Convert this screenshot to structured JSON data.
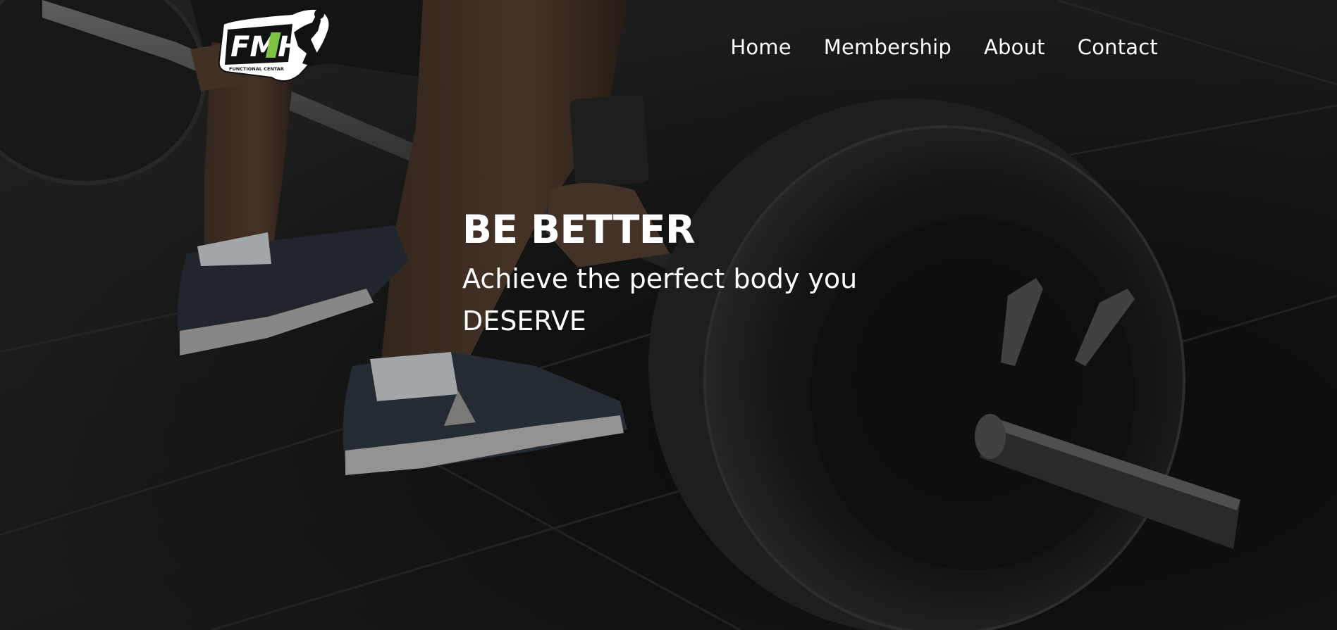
{
  "brand": {
    "logo_text": "FMH",
    "logo_subtext": "FUNCTIONAL CENTAR",
    "accent_color": "#7dc242"
  },
  "nav": {
    "items": [
      {
        "label": "Home"
      },
      {
        "label": "Membership"
      },
      {
        "label": "About"
      },
      {
        "label": "Contact"
      }
    ]
  },
  "hero": {
    "headline": "BE BETTER",
    "subline_1": "Achieve the perfect body you",
    "subline_2": "DESERVE"
  }
}
